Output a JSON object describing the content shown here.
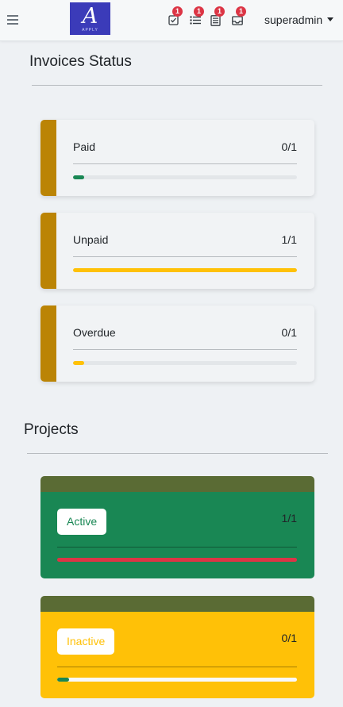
{
  "header": {
    "logo_letter": "A",
    "logo_sub": "APPLY",
    "nav_icons": [
      {
        "name": "tasks-check-icon",
        "badge": "1"
      },
      {
        "name": "list-icon",
        "badge": "1"
      },
      {
        "name": "document-icon",
        "badge": "1"
      },
      {
        "name": "inbox-icon",
        "badge": "1"
      }
    ],
    "user_name": "superadmin"
  },
  "invoices": {
    "title": "Invoices Status",
    "items": [
      {
        "label": "Paid",
        "count": "0/1",
        "progress": 0.05,
        "fill_color": "#198754"
      },
      {
        "label": "Unpaid",
        "count": "1/1",
        "progress": 1.0,
        "fill_color": "#ffc107"
      },
      {
        "label": "Overdue",
        "count": "0/1",
        "progress": 0.05,
        "fill_color": "#ffc107"
      }
    ]
  },
  "projects": {
    "title": "Projects",
    "items": [
      {
        "label": "Active",
        "count": "1/1",
        "progress": 1.0,
        "card_color": "#198754",
        "label_color": "#198754",
        "fill_color": "#dc3545",
        "track_color": "#dc3545"
      },
      {
        "label": "Inactive",
        "count": "0/1",
        "progress": 0.05,
        "card_color": "#ffc107",
        "label_color": "#ffc107",
        "fill_color": "#198754",
        "track_color": "#f8f9fa"
      }
    ]
  },
  "colors": {
    "accent": "#bb8405",
    "header_band": "#5a6b34",
    "logo_bg": "#3b3bb9",
    "badge": "#dc3545"
  }
}
